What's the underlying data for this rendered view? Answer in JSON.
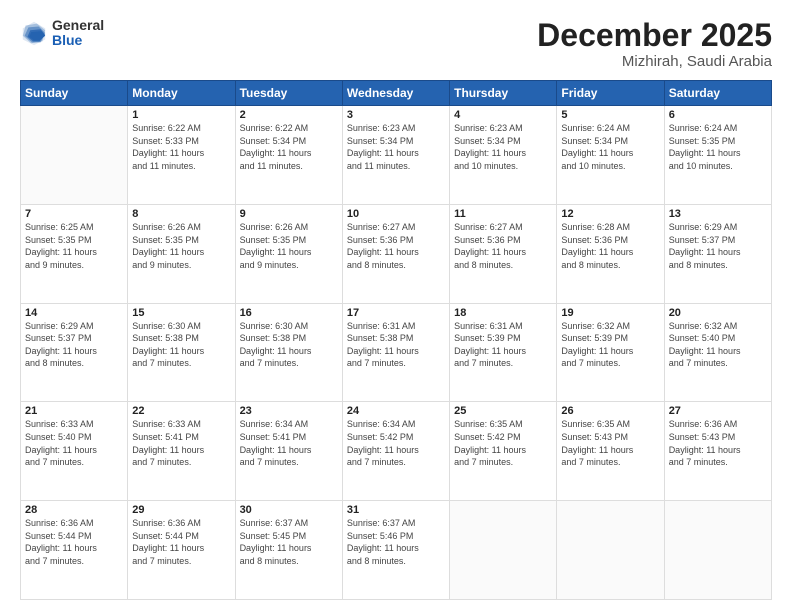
{
  "header": {
    "logo_general": "General",
    "logo_blue": "Blue",
    "month": "December 2025",
    "location": "Mizhirah, Saudi Arabia"
  },
  "weekdays": [
    "Sunday",
    "Monday",
    "Tuesday",
    "Wednesday",
    "Thursday",
    "Friday",
    "Saturday"
  ],
  "weeks": [
    [
      {
        "day": "",
        "info": ""
      },
      {
        "day": "1",
        "info": "Sunrise: 6:22 AM\nSunset: 5:33 PM\nDaylight: 11 hours\nand 11 minutes."
      },
      {
        "day": "2",
        "info": "Sunrise: 6:22 AM\nSunset: 5:34 PM\nDaylight: 11 hours\nand 11 minutes."
      },
      {
        "day": "3",
        "info": "Sunrise: 6:23 AM\nSunset: 5:34 PM\nDaylight: 11 hours\nand 11 minutes."
      },
      {
        "day": "4",
        "info": "Sunrise: 6:23 AM\nSunset: 5:34 PM\nDaylight: 11 hours\nand 10 minutes."
      },
      {
        "day": "5",
        "info": "Sunrise: 6:24 AM\nSunset: 5:34 PM\nDaylight: 11 hours\nand 10 minutes."
      },
      {
        "day": "6",
        "info": "Sunrise: 6:24 AM\nSunset: 5:35 PM\nDaylight: 11 hours\nand 10 minutes."
      }
    ],
    [
      {
        "day": "7",
        "info": "Sunrise: 6:25 AM\nSunset: 5:35 PM\nDaylight: 11 hours\nand 9 minutes."
      },
      {
        "day": "8",
        "info": "Sunrise: 6:26 AM\nSunset: 5:35 PM\nDaylight: 11 hours\nand 9 minutes."
      },
      {
        "day": "9",
        "info": "Sunrise: 6:26 AM\nSunset: 5:35 PM\nDaylight: 11 hours\nand 9 minutes."
      },
      {
        "day": "10",
        "info": "Sunrise: 6:27 AM\nSunset: 5:36 PM\nDaylight: 11 hours\nand 8 minutes."
      },
      {
        "day": "11",
        "info": "Sunrise: 6:27 AM\nSunset: 5:36 PM\nDaylight: 11 hours\nand 8 minutes."
      },
      {
        "day": "12",
        "info": "Sunrise: 6:28 AM\nSunset: 5:36 PM\nDaylight: 11 hours\nand 8 minutes."
      },
      {
        "day": "13",
        "info": "Sunrise: 6:29 AM\nSunset: 5:37 PM\nDaylight: 11 hours\nand 8 minutes."
      }
    ],
    [
      {
        "day": "14",
        "info": "Sunrise: 6:29 AM\nSunset: 5:37 PM\nDaylight: 11 hours\nand 8 minutes."
      },
      {
        "day": "15",
        "info": "Sunrise: 6:30 AM\nSunset: 5:38 PM\nDaylight: 11 hours\nand 7 minutes."
      },
      {
        "day": "16",
        "info": "Sunrise: 6:30 AM\nSunset: 5:38 PM\nDaylight: 11 hours\nand 7 minutes."
      },
      {
        "day": "17",
        "info": "Sunrise: 6:31 AM\nSunset: 5:38 PM\nDaylight: 11 hours\nand 7 minutes."
      },
      {
        "day": "18",
        "info": "Sunrise: 6:31 AM\nSunset: 5:39 PM\nDaylight: 11 hours\nand 7 minutes."
      },
      {
        "day": "19",
        "info": "Sunrise: 6:32 AM\nSunset: 5:39 PM\nDaylight: 11 hours\nand 7 minutes."
      },
      {
        "day": "20",
        "info": "Sunrise: 6:32 AM\nSunset: 5:40 PM\nDaylight: 11 hours\nand 7 minutes."
      }
    ],
    [
      {
        "day": "21",
        "info": "Sunrise: 6:33 AM\nSunset: 5:40 PM\nDaylight: 11 hours\nand 7 minutes."
      },
      {
        "day": "22",
        "info": "Sunrise: 6:33 AM\nSunset: 5:41 PM\nDaylight: 11 hours\nand 7 minutes."
      },
      {
        "day": "23",
        "info": "Sunrise: 6:34 AM\nSunset: 5:41 PM\nDaylight: 11 hours\nand 7 minutes."
      },
      {
        "day": "24",
        "info": "Sunrise: 6:34 AM\nSunset: 5:42 PM\nDaylight: 11 hours\nand 7 minutes."
      },
      {
        "day": "25",
        "info": "Sunrise: 6:35 AM\nSunset: 5:42 PM\nDaylight: 11 hours\nand 7 minutes."
      },
      {
        "day": "26",
        "info": "Sunrise: 6:35 AM\nSunset: 5:43 PM\nDaylight: 11 hours\nand 7 minutes."
      },
      {
        "day": "27",
        "info": "Sunrise: 6:36 AM\nSunset: 5:43 PM\nDaylight: 11 hours\nand 7 minutes."
      }
    ],
    [
      {
        "day": "28",
        "info": "Sunrise: 6:36 AM\nSunset: 5:44 PM\nDaylight: 11 hours\nand 7 minutes."
      },
      {
        "day": "29",
        "info": "Sunrise: 6:36 AM\nSunset: 5:44 PM\nDaylight: 11 hours\nand 7 minutes."
      },
      {
        "day": "30",
        "info": "Sunrise: 6:37 AM\nSunset: 5:45 PM\nDaylight: 11 hours\nand 8 minutes."
      },
      {
        "day": "31",
        "info": "Sunrise: 6:37 AM\nSunset: 5:46 PM\nDaylight: 11 hours\nand 8 minutes."
      },
      {
        "day": "",
        "info": ""
      },
      {
        "day": "",
        "info": ""
      },
      {
        "day": "",
        "info": ""
      }
    ]
  ]
}
